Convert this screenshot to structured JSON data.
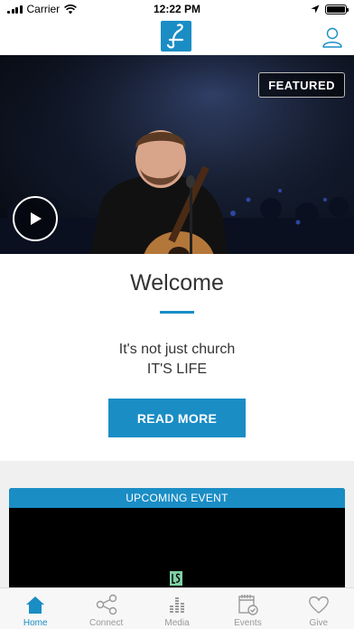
{
  "status_bar": {
    "carrier": "Carrier",
    "time": "12:22 PM"
  },
  "header": {
    "logo_icon": "lifechurch-logo-icon",
    "profile_icon": "profile-icon"
  },
  "hero": {
    "badge": "FEATURED",
    "play_icon": "play-icon"
  },
  "welcome": {
    "title": "Welcome",
    "tagline_line1": "It's not just church",
    "tagline_line2": "IT'S LIFE",
    "button": "READ MORE"
  },
  "event": {
    "header": "UPCOMING EVENT"
  },
  "tabs": [
    {
      "label": "Home",
      "icon": "home-icon",
      "active": true
    },
    {
      "label": "Connect",
      "icon": "share-icon",
      "active": false
    },
    {
      "label": "Media",
      "icon": "media-icon",
      "active": false
    },
    {
      "label": "Events",
      "icon": "calendar-icon",
      "active": false
    },
    {
      "label": "Give",
      "icon": "heart-icon",
      "active": false
    }
  ],
  "colors": {
    "accent": "#1a8dc5"
  }
}
